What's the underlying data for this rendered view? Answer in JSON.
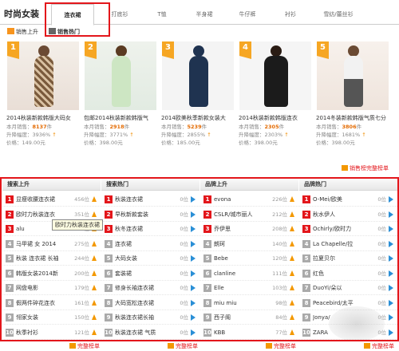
{
  "header": {
    "brand": "时尚女装",
    "tabs": [
      "连衣裙",
      "打底衫",
      "T恤",
      "半身裙",
      "牛仔裤",
      "衬衫",
      "雪纺/蕾丝衫"
    ]
  },
  "subtabs": [
    "销售上升",
    "销售热门"
  ],
  "products": [
    {
      "rank": "1",
      "title": "2014秋装新款韩版大码女",
      "sales_label": "本月销售：",
      "sales": "8137",
      "sales_unit": "件",
      "change_label": "升降幅度：",
      "change": "3936%",
      "price_label": "价格：",
      "price": "149.00元"
    },
    {
      "rank": "2",
      "title": "包邮2014秋装新款韩版气",
      "sales_label": "本月销售：",
      "sales": "2918",
      "sales_unit": "件",
      "change_label": "升降幅度：",
      "change": "3771%",
      "price_label": "价格：",
      "price": "398.00元"
    },
    {
      "rank": "3",
      "title": "2014欧美秋季新款女装大",
      "sales_label": "本月销售：",
      "sales": "5239",
      "sales_unit": "件",
      "change_label": "升降幅度：",
      "change": "2855%",
      "price_label": "价格：",
      "price": "185.00元"
    },
    {
      "rank": "4",
      "title": "2014秋装新款韩版连衣",
      "sales_label": "本月销售：",
      "sales": "2305",
      "sales_unit": "件",
      "change_label": "升降幅度：",
      "change": "2303%",
      "price_label": "价格：",
      "price": "398.00元"
    },
    {
      "rank": "5",
      "title": "2014冬装新款韩版气质七分",
      "sales_label": "本月销售：",
      "sales": "3806",
      "sales_unit": "件",
      "change_label": "升降幅度：",
      "change": "1681%",
      "price_label": "价格：",
      "price": "398.00元"
    }
  ],
  "more_top": "销售榜完整榜单",
  "columns": [
    {
      "title": "搜索上升",
      "rows": [
        {
          "kw": "显瘦收腰连衣裙",
          "val": "456位"
        },
        {
          "kw": "欧时力秋装连衣",
          "val": "351位"
        },
        {
          "kw": "alu",
          "val": "326位"
        },
        {
          "kw": "马甲裙 女 2014",
          "val": "275位"
        },
        {
          "kw": "秋装 连衣裙 长袖",
          "val": "244位"
        },
        {
          "kw": "韩版女装2014新",
          "val": "200位"
        },
        {
          "kw": "网盘电影",
          "val": "179位"
        },
        {
          "kw": "假两件碎花连衣",
          "val": "161位"
        },
        {
          "kw": "翎家女装",
          "val": "150位"
        },
        {
          "kw": "秋季衬衫",
          "val": "121位"
        }
      ]
    },
    {
      "title": "搜索热门",
      "rows": [
        {
          "kw": "秋装连衣裙",
          "val": "0位"
        },
        {
          "kw": "早秋新款套装",
          "val": "0位"
        },
        {
          "kw": "秋冬连衣裙",
          "val": "0位"
        },
        {
          "kw": "连衣裙",
          "val": "0位"
        },
        {
          "kw": "大码女装",
          "val": "0位"
        },
        {
          "kw": "套装裙",
          "val": "0位"
        },
        {
          "kw": "修身长袖连衣裙",
          "val": "0位"
        },
        {
          "kw": "大码宽松连衣裙",
          "val": "0位"
        },
        {
          "kw": "秋装连衣裙长袖",
          "val": "0位"
        },
        {
          "kw": "秋装连衣裙 气质",
          "val": "0位"
        }
      ]
    },
    {
      "title": "品牌上升",
      "rows": [
        {
          "kw": "evona",
          "val": "226位"
        },
        {
          "kw": "CSLR/城市丽人",
          "val": "212位"
        },
        {
          "kw": "乔伊思",
          "val": "208位"
        },
        {
          "kw": "朗珂",
          "val": "140位"
        },
        {
          "kw": "Bebe",
          "val": "120位"
        },
        {
          "kw": "clanline",
          "val": "111位"
        },
        {
          "kw": "Elle",
          "val": "103位"
        },
        {
          "kw": "miu miu",
          "val": "98位"
        },
        {
          "kw": "西子阁",
          "val": "84位"
        },
        {
          "kw": "KBB",
          "val": "77位"
        }
      ]
    },
    {
      "title": "品牌热门",
      "rows": [
        {
          "kw": "O-Mei/欧美",
          "val": "0位"
        },
        {
          "kw": "秋水伊人",
          "val": "0位"
        },
        {
          "kw": "Ochirly/欧时力",
          "val": "0位"
        },
        {
          "kw": "La Chapelle/拉",
          "val": "0位"
        },
        {
          "kw": "拉夏贝尔",
          "val": "0位"
        },
        {
          "kw": "红色",
          "val": "0位"
        },
        {
          "kw": "DuoYi/朵以",
          "val": "0位"
        },
        {
          "kw": "Peacebird/太平",
          "val": "0位"
        },
        {
          "kw": "Jonya/",
          "val": "0位"
        },
        {
          "kw": "ZARA",
          "val": "0位"
        }
      ]
    }
  ],
  "tooltip": "欧时力秋装连衣裙",
  "more_bottom": "完整榜单",
  "colors": {
    "accent": "#e3161b",
    "orange": "#f39800",
    "blue": "#2a8fd6"
  }
}
